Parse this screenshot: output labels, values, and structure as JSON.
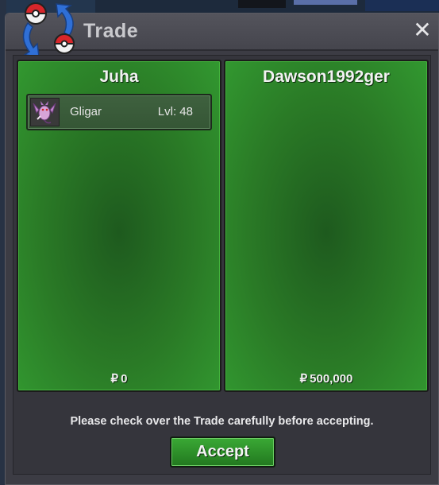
{
  "window": {
    "title": "Trade",
    "close_symbol": "✕",
    "logo_icon": "pokeball-swap-icon"
  },
  "left_panel": {
    "player_name": "Juha",
    "items": [
      {
        "name": "Gligar",
        "level": "Lvl: 48",
        "icon": "gligar-sprite-icon"
      }
    ],
    "currency_symbol": "₽",
    "money": "0"
  },
  "right_panel": {
    "player_name": "Dawson1992ger",
    "items": [],
    "currency_symbol": "₽",
    "money": "500,000"
  },
  "notice": "Please check over the Trade carefully before accepting.",
  "accept_label": "Accept",
  "colors": {
    "panel_green": "#2a7a26",
    "accept_green": "#2e9a2a",
    "window_bg": "#3c3c44"
  }
}
